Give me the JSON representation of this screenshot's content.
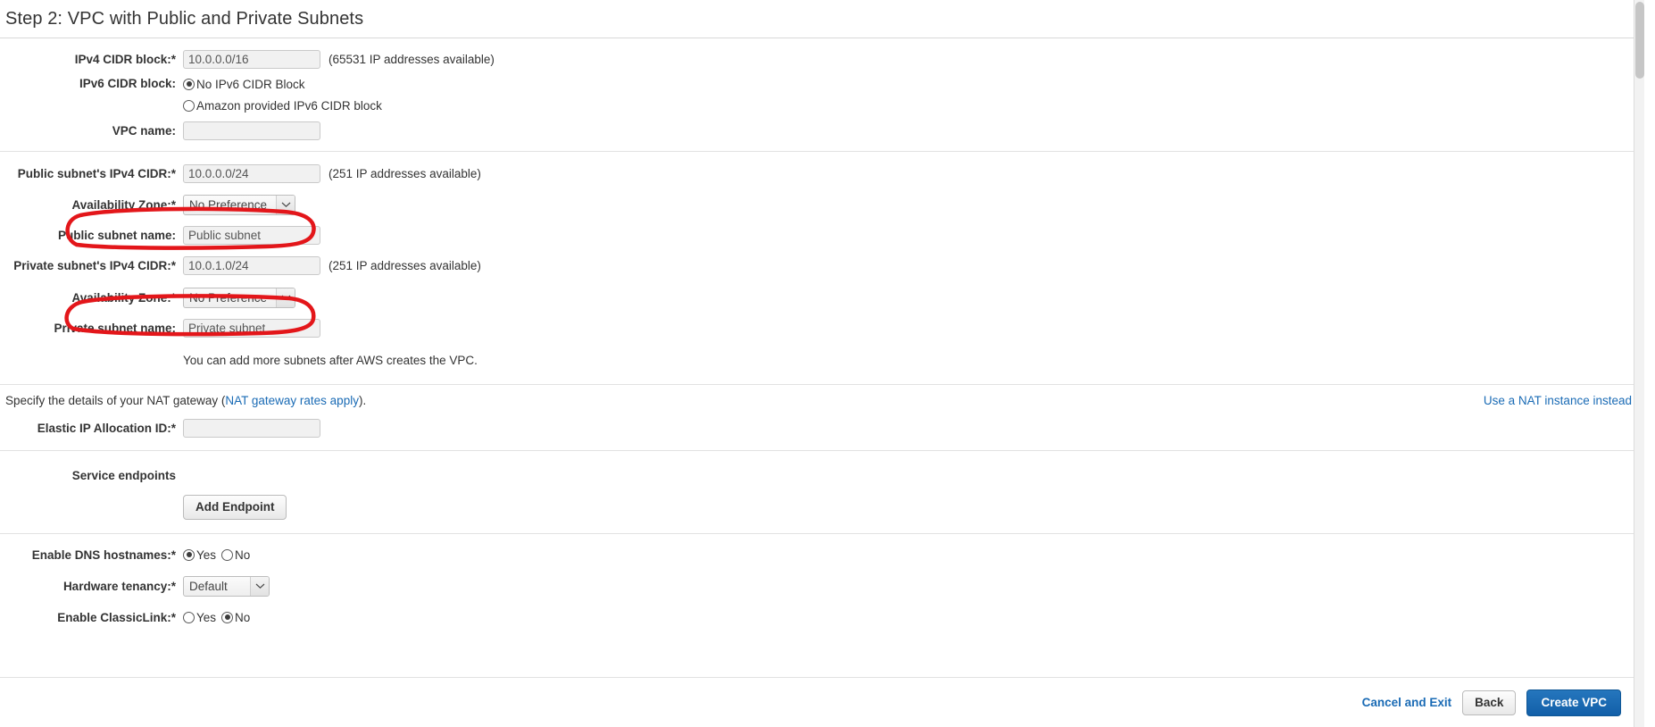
{
  "window": {
    "title": "Step 2: VPC with Public and Private Subnets"
  },
  "vpc_section": {
    "ipv4_label": "IPv4 CIDR block:*",
    "ipv4_value": "10.0.0.0/16",
    "ipv4_hint": "(65531 IP addresses available)",
    "ipv6_label": "IPv6 CIDR block:",
    "ipv6_options": [
      {
        "label": "No IPv6 CIDR Block",
        "selected": true
      },
      {
        "label": "Amazon provided IPv6 CIDR block",
        "selected": false
      }
    ],
    "vpc_name_label": "VPC name:",
    "vpc_name_value": "",
    "vpc_name_placeholder": ""
  },
  "subnet_section": {
    "public_cidr_label": "Public subnet's IPv4 CIDR:*",
    "public_cidr_value": "10.0.0.0/24",
    "public_cidr_hint": "(251 IP addresses available)",
    "public_az_label": "Availability Zone:*",
    "public_az_value": "No Preference",
    "public_name_label": "Public subnet name:",
    "public_name_value": "Public subnet",
    "private_cidr_label": "Private subnet's IPv4 CIDR:*",
    "private_cidr_value": "10.0.1.0/24",
    "private_cidr_hint": "(251 IP addresses available)",
    "private_az_label": "Availability Zone:*",
    "private_az_value": "No Preference",
    "private_name_label": "Private subnet name:",
    "private_name_value": "Private subnet",
    "note": "You can add more subnets after AWS creates the VPC."
  },
  "nat_section": {
    "text_before": "Specify the details of your NAT gateway (",
    "rates_link": "NAT gateway rates apply",
    "text_after": ").",
    "nat_instance_link": "Use a NAT instance instead",
    "eip_label": "Elastic IP Allocation ID:*",
    "eip_value": ""
  },
  "endpoints_section": {
    "label": "Service endpoints",
    "add_button": "Add Endpoint"
  },
  "options_section": {
    "dns_label": "Enable DNS hostnames:*",
    "dns_options": [
      {
        "label": "Yes",
        "selected": true
      },
      {
        "label": "No",
        "selected": false
      }
    ],
    "tenancy_label": "Hardware tenancy:*",
    "tenancy_value": "Default",
    "classiclink_label": "Enable ClassicLink:*",
    "classiclink_options": [
      {
        "label": "Yes",
        "selected": false
      },
      {
        "label": "No",
        "selected": true
      }
    ]
  },
  "footer": {
    "cancel_label": "Cancel and Exit",
    "back_label": "Back",
    "create_label": "Create VPC"
  },
  "annotations": {
    "color": "#e3161a",
    "shapes": [
      {
        "name": "public-az-highlight"
      },
      {
        "name": "private-az-highlight"
      }
    ]
  }
}
